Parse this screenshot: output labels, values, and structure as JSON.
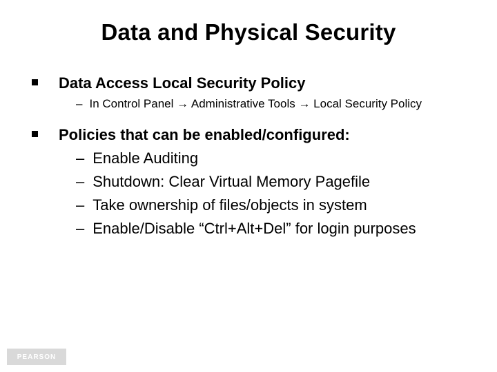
{
  "title": "Data and Physical Security",
  "section1": {
    "heading": "Data Access Local Security Policy",
    "sub": "In Control Panel → Administrative Tools → Local Security Policy"
  },
  "section2": {
    "heading": "Policies that can be enabled/configured:",
    "items": [
      "Enable Auditing",
      "Shutdown: Clear Virtual Memory Pagefile",
      "Take ownership of files/objects in system",
      "Enable/Disable “Ctrl+Alt+Del” for login purposes"
    ]
  },
  "footer": {
    "logo_text": "PEARSON"
  }
}
